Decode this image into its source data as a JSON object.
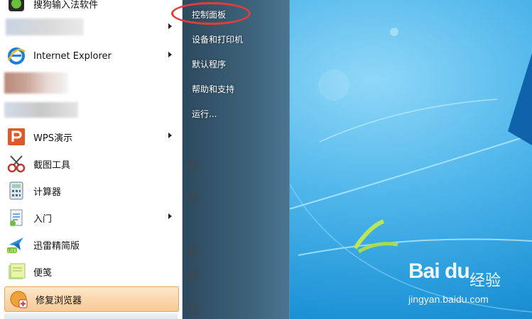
{
  "left_pane": {
    "items": [
      {
        "label": "搜狗输入法软件",
        "icon": "app-icon"
      },
      {
        "label": "",
        "icon": "blurred-icon"
      },
      {
        "label": "Internet Explorer",
        "icon": "internet-explorer-icon"
      },
      {
        "label": "",
        "icon": "blurred-icon"
      },
      {
        "label": "",
        "icon": "blurred-icon"
      },
      {
        "label": "WPS演示",
        "icon": "wps-presentation-icon"
      },
      {
        "label": "截图工具",
        "icon": "snipping-tool-icon"
      },
      {
        "label": "计算器",
        "icon": "calculator-icon"
      },
      {
        "label": "入门",
        "icon": "getting-started-icon"
      },
      {
        "label": "迅雷精简版",
        "icon": "xunlei-lite-icon"
      },
      {
        "label": "便笺",
        "icon": "sticky-notes-icon"
      },
      {
        "label": "修复浏览器",
        "icon": "repair-browser-icon"
      }
    ]
  },
  "right_pane": {
    "items": [
      {
        "label": "控制面板"
      },
      {
        "label": "设备和打印机"
      },
      {
        "label": "默认程序"
      },
      {
        "label": "帮助和支持"
      },
      {
        "label": "运行..."
      }
    ]
  },
  "watermark": {
    "logo": "Bai du",
    "cn": "经验",
    "url": "jingyan.baidu.com"
  },
  "colors": {
    "annotation": "#e43b3b",
    "desktop": "#1d93d6",
    "highlight": "#f7c994"
  }
}
